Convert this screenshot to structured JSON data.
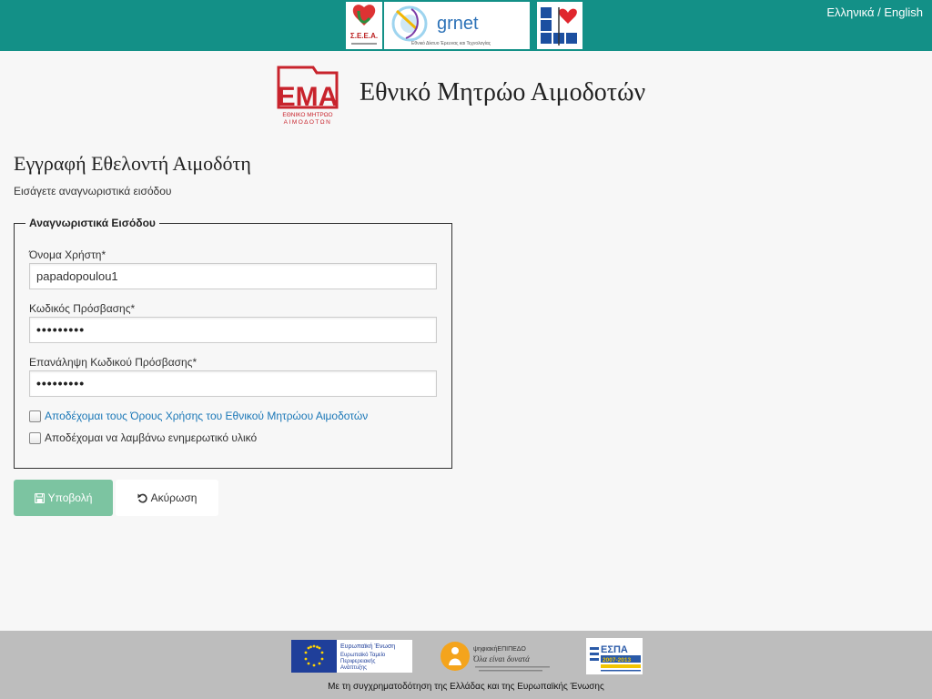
{
  "header": {
    "language_switch": "Ελληνικά / English",
    "logos": {
      "esea_text": "Σ.Ε.Ε.Α.",
      "grnet_text": "grnet",
      "grnet_subtitle": "Εθνικό Δίκτυο Έρευνας και Τεχνολογίας"
    },
    "brand_mark": "ΕΜΑ",
    "brand_mark_sub_1": "ΕΘΝΙΚΟ ΜΗΤΡΩΟ",
    "brand_mark_sub_2": "ΑΙΜΟΔΟΤΩΝ",
    "brand_title": "Εθνικό Μητρώο Αιμοδοτών"
  },
  "page": {
    "title": "Εγγραφή Εθελοντή Αιμοδότη",
    "subtitle": "Εισάγετε αναγνωριστικά εισόδου"
  },
  "form": {
    "legend": "Αναγνωριστικά Εισόδου",
    "username_label": "Όνομα Χρήστη*",
    "username_value": "papadopoulou1",
    "password_label": "Κωδικός Πρόσβασης*",
    "password_mask": "•••••••••",
    "password_repeat_label": "Επανάληψη Κωδικού Πρόσβασης*",
    "password_repeat_mask": "•••••••••",
    "terms_link": "Αποδέχομαι τους Όρους Χρήσης του Εθνικού Μητρώου Αιμοδοτών",
    "newsletter_label": "Αποδέχομαι να λαμβάνω ενημερωτικό υλικό",
    "terms_checked": false,
    "newsletter_checked": false
  },
  "actions": {
    "submit_label": "Υποβολή",
    "cancel_label": "Ακύρωση"
  },
  "footer": {
    "eu_line1": "Ευρωπαϊκή Ένωση",
    "eu_line2": "Ευρωπαϊκό Ταμείο",
    "eu_line3": "Περιφερειακής",
    "eu_line4": "Ανάπτυξης",
    "digital_line1": "ψηφιακήΕΠΙΠΕΔΟ",
    "digital_line2": "Όλα είναι δυνατά",
    "espa_text": "ΕΣΠΑ",
    "espa_years": "2007-2013",
    "cofunding_text": "Με τη συγχρηματοδότηση της Ελλάδας και της Ευρωπαϊκής Ένωσης"
  },
  "colors": {
    "topbar": "#139087",
    "submit": "#7cc4a1",
    "link": "#1a77b7",
    "brand_red": "#c8232c",
    "footer": "#bdbdbd"
  }
}
